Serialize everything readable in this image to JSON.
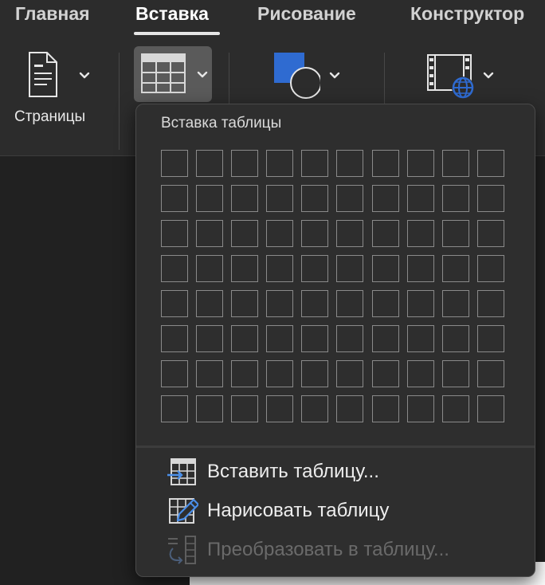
{
  "ribbon": {
    "tabs": [
      {
        "label": "Главная",
        "active": false
      },
      {
        "label": "Вставка",
        "active": true
      },
      {
        "label": "Рисование",
        "active": false
      },
      {
        "label": "Конструктор",
        "active": false
      }
    ],
    "pages_button": {
      "label": "Страницы",
      "icon": "page-icon"
    },
    "table_button": {
      "icon": "table-grid-icon"
    },
    "shapes_button": {
      "icon": "shapes-icon",
      "accent": "#2f6bd1"
    },
    "media_button": {
      "icon": "online-video-icon",
      "accent": "#2f6bd1"
    }
  },
  "dropdown": {
    "title": "Вставка таблицы",
    "grid": {
      "columns": 10,
      "rows": 8
    },
    "menu": [
      {
        "label": "Вставить таблицу...",
        "icon": "insert-table-icon",
        "enabled": true
      },
      {
        "label": "Нарисовать таблицу",
        "icon": "draw-table-icon",
        "enabled": true
      },
      {
        "label": "Преобразовать в таблицу...",
        "icon": "convert-to-table-icon",
        "enabled": false
      }
    ]
  },
  "colors": {
    "ribbon_bg": "#2c2c2c",
    "menu_bg": "#2e2e2e",
    "accent_blue": "#2f6bd1",
    "text": "#eeeeee",
    "disabled_text": "#6a6a6a"
  }
}
